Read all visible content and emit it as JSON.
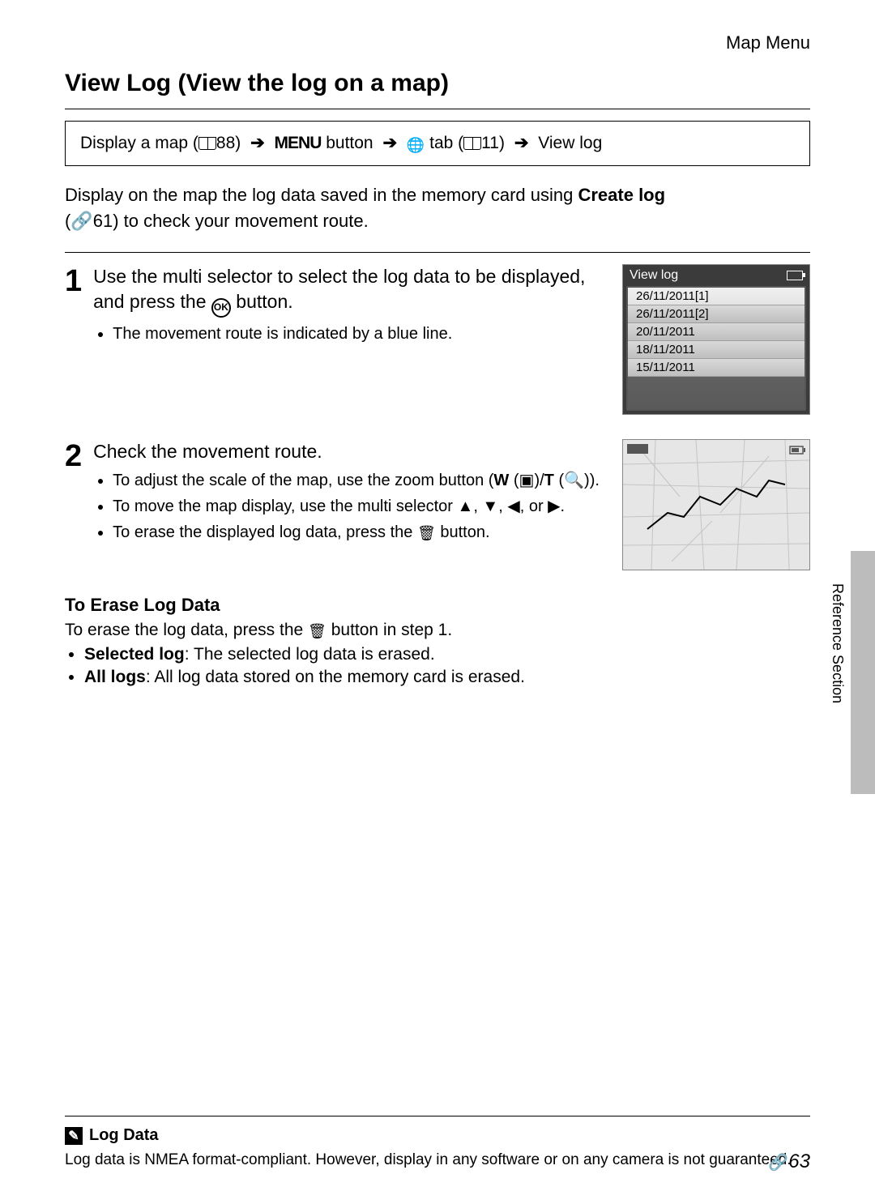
{
  "header": {
    "category": "Map Menu"
  },
  "title": "View Log (View the log on a map)",
  "navpath": {
    "prefix": "Display a map (",
    "ref1": "88",
    "menu_label": "MENU",
    "button_word": " button ",
    "tab_word": " tab (",
    "ref2": "11",
    "end": "View log"
  },
  "intro": {
    "line1_a": "Display on the map the log data saved in the memory card using ",
    "line1_b": "Create log",
    "line2_a": "(",
    "line2_ref": "61",
    "line2_b": ") to check your movement route."
  },
  "step1": {
    "num": "1",
    "title_a": "Use the multi selector to select the log data to be displayed, and press the ",
    "title_b": " button.",
    "bullet1": "The movement route is indicated by a blue line."
  },
  "lcd1": {
    "header": "View log",
    "items": [
      "26/11/2011[1]",
      "26/11/2011[2]",
      "20/11/2011",
      "18/11/2011",
      "15/11/2011"
    ]
  },
  "step2": {
    "num": "2",
    "title": "Check the movement route.",
    "b1_a": "To adjust the scale of the map, use the zoom button (",
    "b1_w": "W",
    "b1_sep": "/",
    "b1_t": "T",
    "b1_end": ").",
    "b2": "To move the map display, use the multi selector ▲, ▼, ◀, or ▶.",
    "b3_a": "To erase the displayed log data, press the ",
    "b3_b": " button."
  },
  "erase": {
    "heading": "To Erase Log Data",
    "line_a": "To erase the log data, press the ",
    "line_b": " button in step 1.",
    "opt1_label": "Selected log",
    "opt1_text": ": The selected log data is erased.",
    "opt2_label": "All logs",
    "opt2_text": ": All log data stored on the memory card is erased."
  },
  "side": {
    "label": "Reference Section"
  },
  "note": {
    "title": "Log Data",
    "body": "Log data is NMEA format-compliant. However, display in any software or on any camera is not guaranteed."
  },
  "pagenum": "63"
}
